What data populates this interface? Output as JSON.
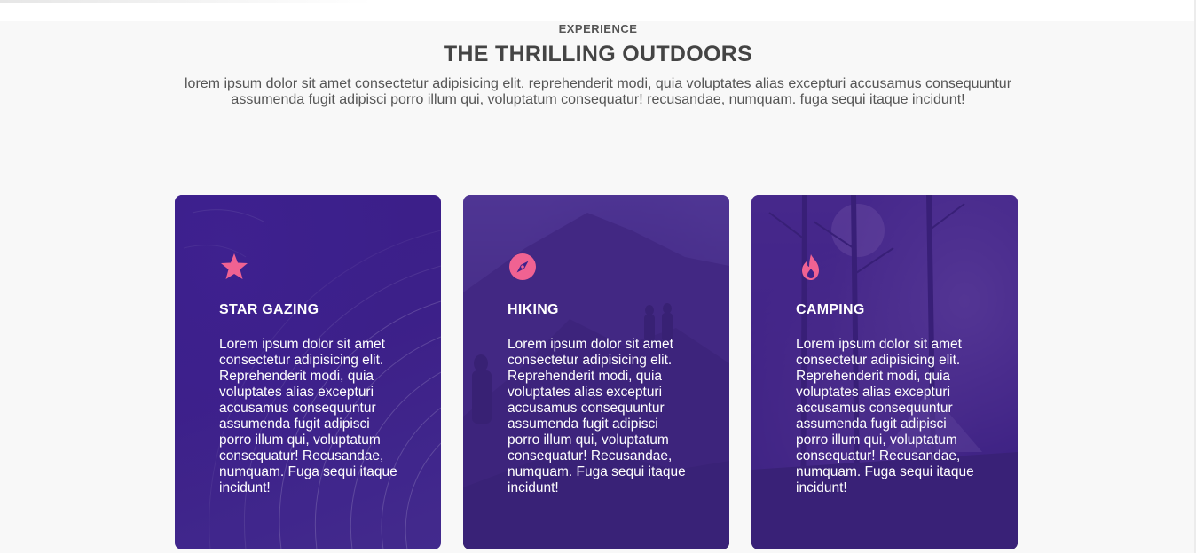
{
  "section": {
    "eyebrow": "EXPERIENCE",
    "title": "THE THRILLING OUTDOORS",
    "lead": "lorem ipsum dolor sit amet consectetur adipisicing elit. reprehenderit modi, quia voluptates alias excepturi accusamus consequuntur assumenda fugit adipisci porro illum qui, voluptatum consequatur! recusandae, numquam. fuga sequi itaque incidunt!"
  },
  "colors": {
    "accent": "#f06292",
    "card_overlay": "#3e218c",
    "heading": "#444444",
    "page_bg": "#f8f8f8"
  },
  "cards": [
    {
      "icon": "star-icon",
      "title": "STAR GAZING",
      "text": "Lorem ipsum dolor sit amet consectetur adipisicing elit. Reprehenderit modi, quia voluptates alias excepturi accusamus consequuntur assumenda fugit adipisci porro illum qui, voluptatum consequatur! Recusandae, numquam. Fuga sequi itaque incidunt!"
    },
    {
      "icon": "compass-icon",
      "title": "HIKING",
      "text": "Lorem ipsum dolor sit amet consectetur adipisicing elit. Reprehenderit modi, quia voluptates alias excepturi accusamus consequuntur assumenda fugit adipisci porro illum qui, voluptatum consequatur! Recusandae, numquam. Fuga sequi itaque incidunt!"
    },
    {
      "icon": "fire-icon",
      "title": "CAMPING",
      "text": "Lorem ipsum dolor sit amet consectetur adipisicing elit. Reprehenderit modi, quia voluptates alias excepturi accusamus consequuntur assumenda fugit adipisci porro illum qui, voluptatum consequatur! Recusandae, numquam. Fuga sequi itaque incidunt!"
    }
  ]
}
